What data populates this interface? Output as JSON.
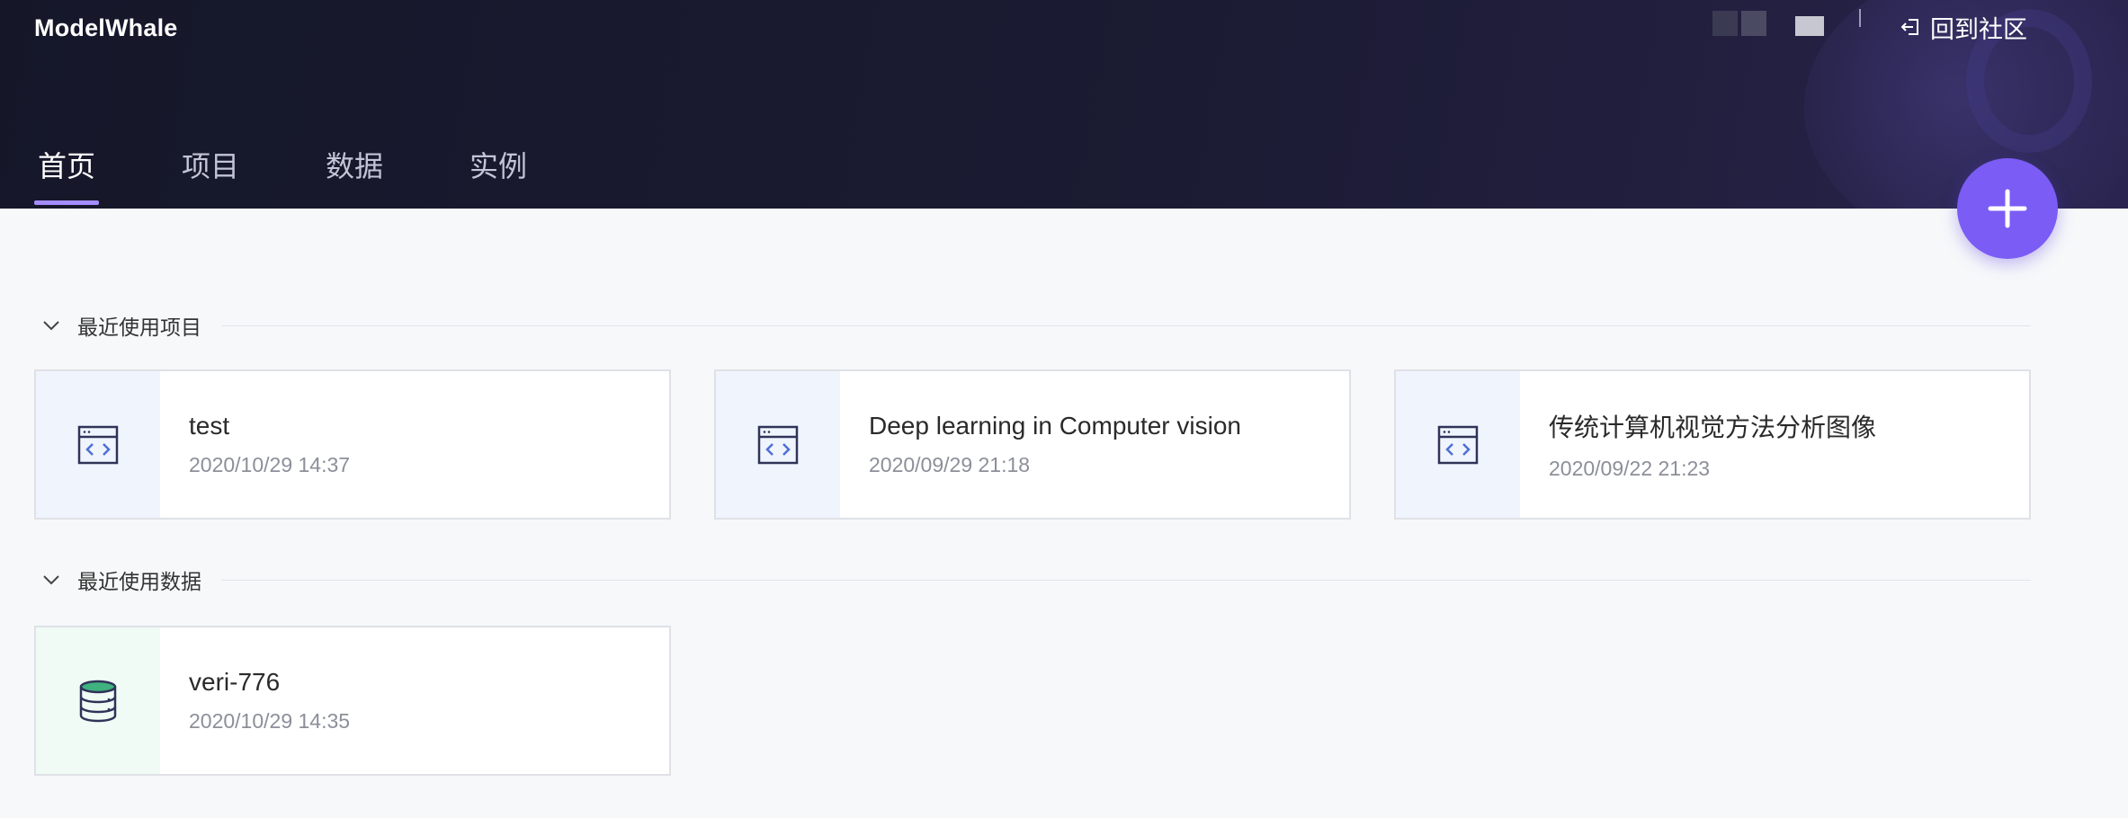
{
  "header": {
    "logo": "ModelWhale",
    "back_link": "回到社区",
    "tabs": [
      {
        "label": "首页",
        "active": true
      },
      {
        "label": "项目",
        "active": false
      },
      {
        "label": "数据",
        "active": false
      },
      {
        "label": "实例",
        "active": false
      }
    ],
    "fab_icon": "plus-icon"
  },
  "sections": {
    "recent_projects": {
      "title": "最近使用项目",
      "items": [
        {
          "name": "test",
          "date": "2020/10/29 14:37",
          "icon": "code-window-icon"
        },
        {
          "name": "Deep learning in Computer vision",
          "date": "2020/09/29 21:18",
          "icon": "code-window-icon"
        },
        {
          "name": "传统计算机视觉方法分析图像",
          "date": "2020/09/22 21:23",
          "icon": "code-window-icon"
        }
      ]
    },
    "recent_datasets": {
      "title": "最近使用数据",
      "items": [
        {
          "name": "veri-776",
          "date": "2020/10/29 14:35",
          "icon": "database-icon"
        }
      ]
    }
  },
  "colors": {
    "header_bg": "#181a2e",
    "accent": "#7b5cf5",
    "tab_indicator": "#a48dff",
    "project_icon_bg": "#f0f4fd",
    "dataset_icon_bg": "#f0fbf5"
  }
}
